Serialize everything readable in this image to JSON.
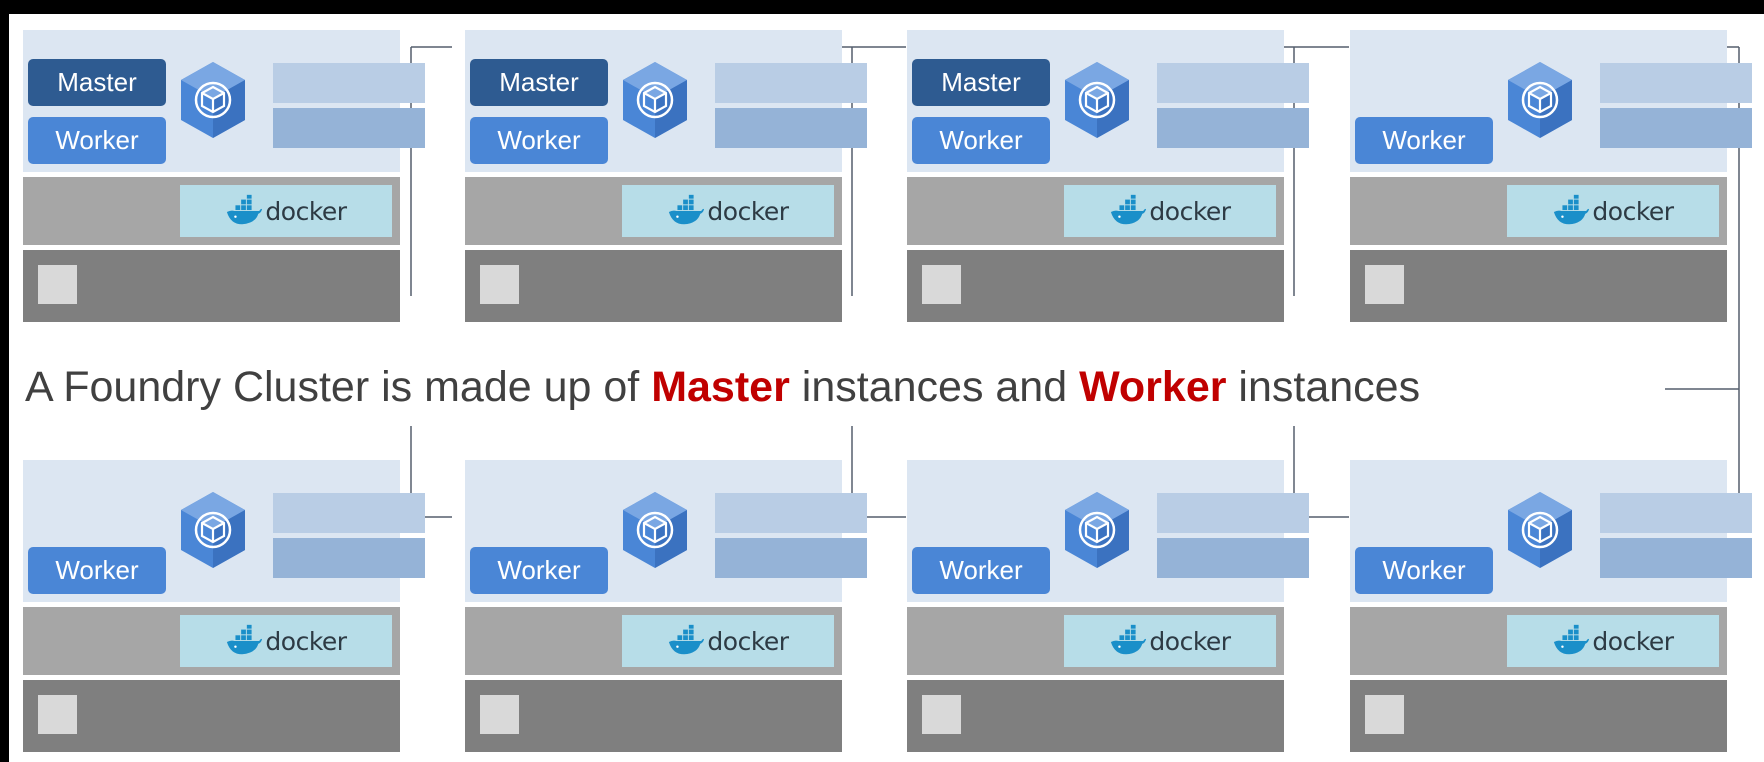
{
  "caption": {
    "prefix": "A Foundry Cluster is made up of",
    "highlight_master": "Master",
    "middle": "instances and",
    "highlight_worker": "Worker",
    "suffix": "instances"
  },
  "role_labels": {
    "master": "Master",
    "worker": "Worker"
  },
  "docker_label": "docker",
  "colors": {
    "highlight": "#c00000",
    "master_badge": "#2e5b91",
    "worker_badge": "#4a86d6",
    "app_layer": "#dce6f2",
    "docker_layer": "#a6a6a6",
    "os_layer": "#7f7f7f",
    "docker_badge": "#b7dde8",
    "docker_whale": "#1a8fc9",
    "cube": "#4a86d6",
    "connector": "#555f6d"
  },
  "nodes": [
    {
      "roles": [
        "Master",
        "Worker"
      ]
    },
    {
      "roles": [
        "Master",
        "Worker"
      ]
    },
    {
      "roles": [
        "Master",
        "Worker"
      ]
    },
    {
      "roles": [
        "Worker"
      ]
    },
    {
      "roles": [
        "Worker"
      ]
    },
    {
      "roles": [
        "Worker"
      ]
    },
    {
      "roles": [
        "Worker"
      ]
    },
    {
      "roles": [
        "Worker"
      ]
    }
  ],
  "icons": {
    "cube": "hexagon-cube-icon",
    "docker": "docker-whale-icon"
  }
}
